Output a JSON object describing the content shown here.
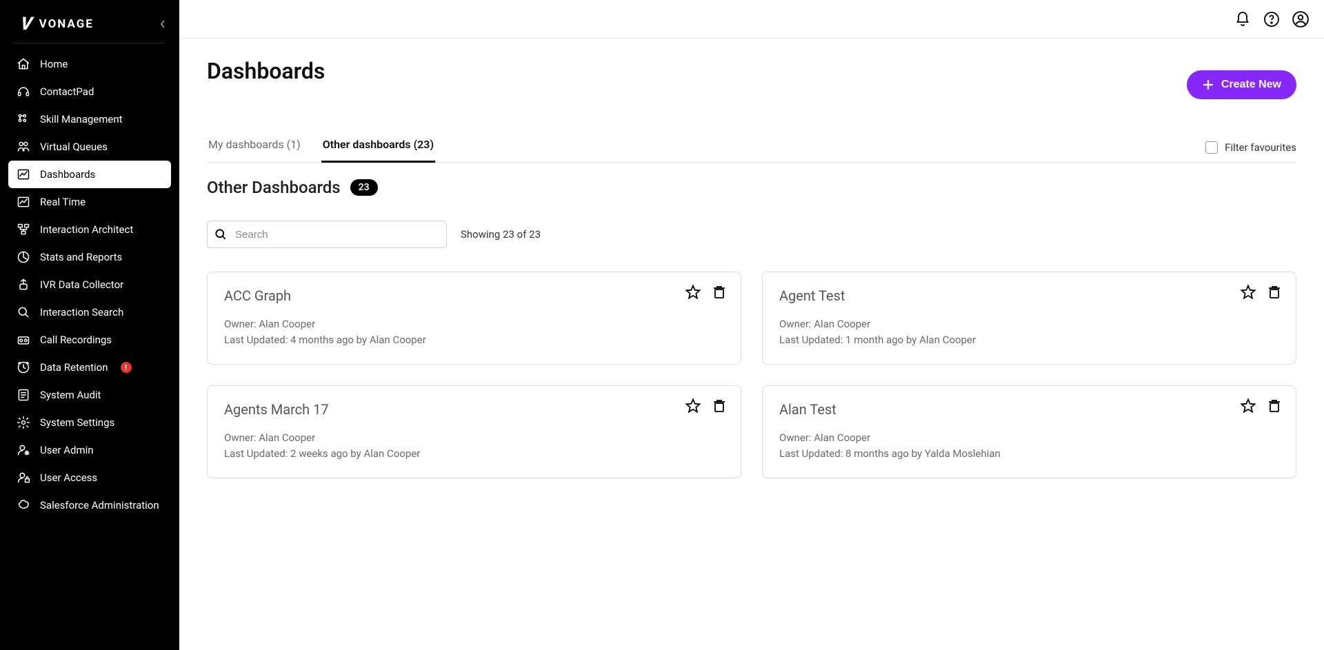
{
  "brand": {
    "name": "VONAGE"
  },
  "sidebar": {
    "items": [
      {
        "label": "Home",
        "icon": "home-icon"
      },
      {
        "label": "ContactPad",
        "icon": "headset-icon"
      },
      {
        "label": "Skill Management",
        "icon": "skills-icon"
      },
      {
        "label": "Virtual Queues",
        "icon": "queues-icon"
      },
      {
        "label": "Dashboards",
        "icon": "dashboard-icon",
        "active": true
      },
      {
        "label": "Real Time",
        "icon": "realtime-icon"
      },
      {
        "label": "Interaction Architect",
        "icon": "architect-icon"
      },
      {
        "label": "Stats and Reports",
        "icon": "stats-icon"
      },
      {
        "label": "IVR Data Collector",
        "icon": "ivr-icon"
      },
      {
        "label": "Interaction Search",
        "icon": "search-icon"
      },
      {
        "label": "Call Recordings",
        "icon": "recordings-icon"
      },
      {
        "label": "Data Retention",
        "icon": "retention-icon",
        "alert": "!"
      },
      {
        "label": "System Audit",
        "icon": "audit-icon"
      },
      {
        "label": "System Settings",
        "icon": "settings-icon"
      },
      {
        "label": "User Admin",
        "icon": "user-admin-icon"
      },
      {
        "label": "User Access",
        "icon": "user-access-icon"
      },
      {
        "label": "Salesforce Administration",
        "icon": "salesforce-icon"
      }
    ]
  },
  "page": {
    "title": "Dashboards",
    "create_label": "Create New",
    "tabs": [
      {
        "label": "My dashboards (1)"
      },
      {
        "label": "Other dashboards (23)",
        "active": true
      }
    ],
    "filter_fav_label": "Filter favourites",
    "section_title": "Other Dashboards",
    "section_count": "23",
    "search_placeholder": "Search",
    "showing_text": "Showing 23 of 23"
  },
  "cards": [
    {
      "title": "ACC Graph",
      "owner": "Owner: Alan Cooper",
      "updated": "Last Updated: 4 months ago by Alan Cooper"
    },
    {
      "title": "Agent Test",
      "owner": "Owner: Alan Cooper",
      "updated": "Last Updated: 1 month ago by Alan Cooper"
    },
    {
      "title": "Agents March 17",
      "owner": "Owner: Alan Cooper",
      "updated": "Last Updated: 2 weeks ago by Alan Cooper"
    },
    {
      "title": "Alan Test",
      "owner": "Owner: Alan Cooper",
      "updated": "Last Updated: 8 months ago by Yalda Moslehian"
    }
  ]
}
